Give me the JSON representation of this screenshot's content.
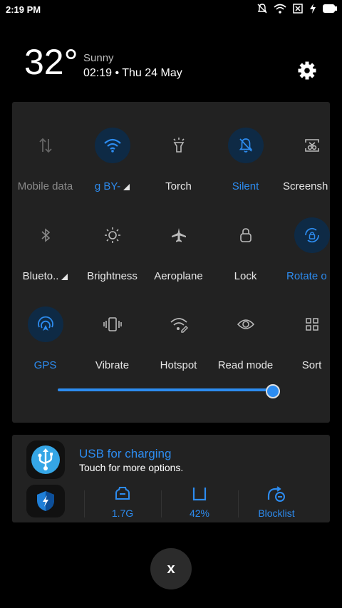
{
  "status_bar": {
    "time": "2:19 PM"
  },
  "weather": {
    "temperature": "32°",
    "condition": "Sunny",
    "datetime": "02:19 • Thu 24 May"
  },
  "quick_settings": {
    "row1": [
      {
        "label": "Mobile data",
        "icon": "mobile-data-icon"
      },
      {
        "label": "g   BY-",
        "icon": "wifi-icon"
      },
      {
        "label": "Torch",
        "icon": "torch-icon"
      },
      {
        "label": "Silent",
        "icon": "silent-icon"
      },
      {
        "label": "Screensh",
        "icon": "screenshot-icon"
      }
    ],
    "row2": [
      {
        "label": "Blueto..",
        "icon": "bluetooth-icon"
      },
      {
        "label": "Brightness",
        "icon": "brightness-icon"
      },
      {
        "label": "Aeroplane",
        "icon": "aeroplane-icon"
      },
      {
        "label": "Lock",
        "icon": "lock-icon"
      },
      {
        "label": "Rotate o",
        "icon": "rotate-lock-icon"
      }
    ],
    "row3": [
      {
        "label": "GPS",
        "icon": "gps-icon"
      },
      {
        "label": "Vibrate",
        "icon": "vibrate-icon"
      },
      {
        "label": "Hotspot",
        "icon": "hotspot-icon"
      },
      {
        "label": "Read mode",
        "icon": "read-mode-icon"
      },
      {
        "label": "Sort",
        "icon": "sort-icon"
      }
    ],
    "brightness_level": 0.96
  },
  "notification": {
    "title": "USB for charging",
    "subtitle": "Touch for more options.",
    "stats": [
      {
        "label": "1.7G",
        "icon": "memory-icon"
      },
      {
        "label": "42%",
        "icon": "storage-icon"
      },
      {
        "label": "Blocklist",
        "icon": "blocklist-icon"
      }
    ]
  },
  "close_button": {
    "label": "x"
  },
  "colors": {
    "accent": "#2d8cf0",
    "panel": "#222222",
    "background": "#000000"
  }
}
